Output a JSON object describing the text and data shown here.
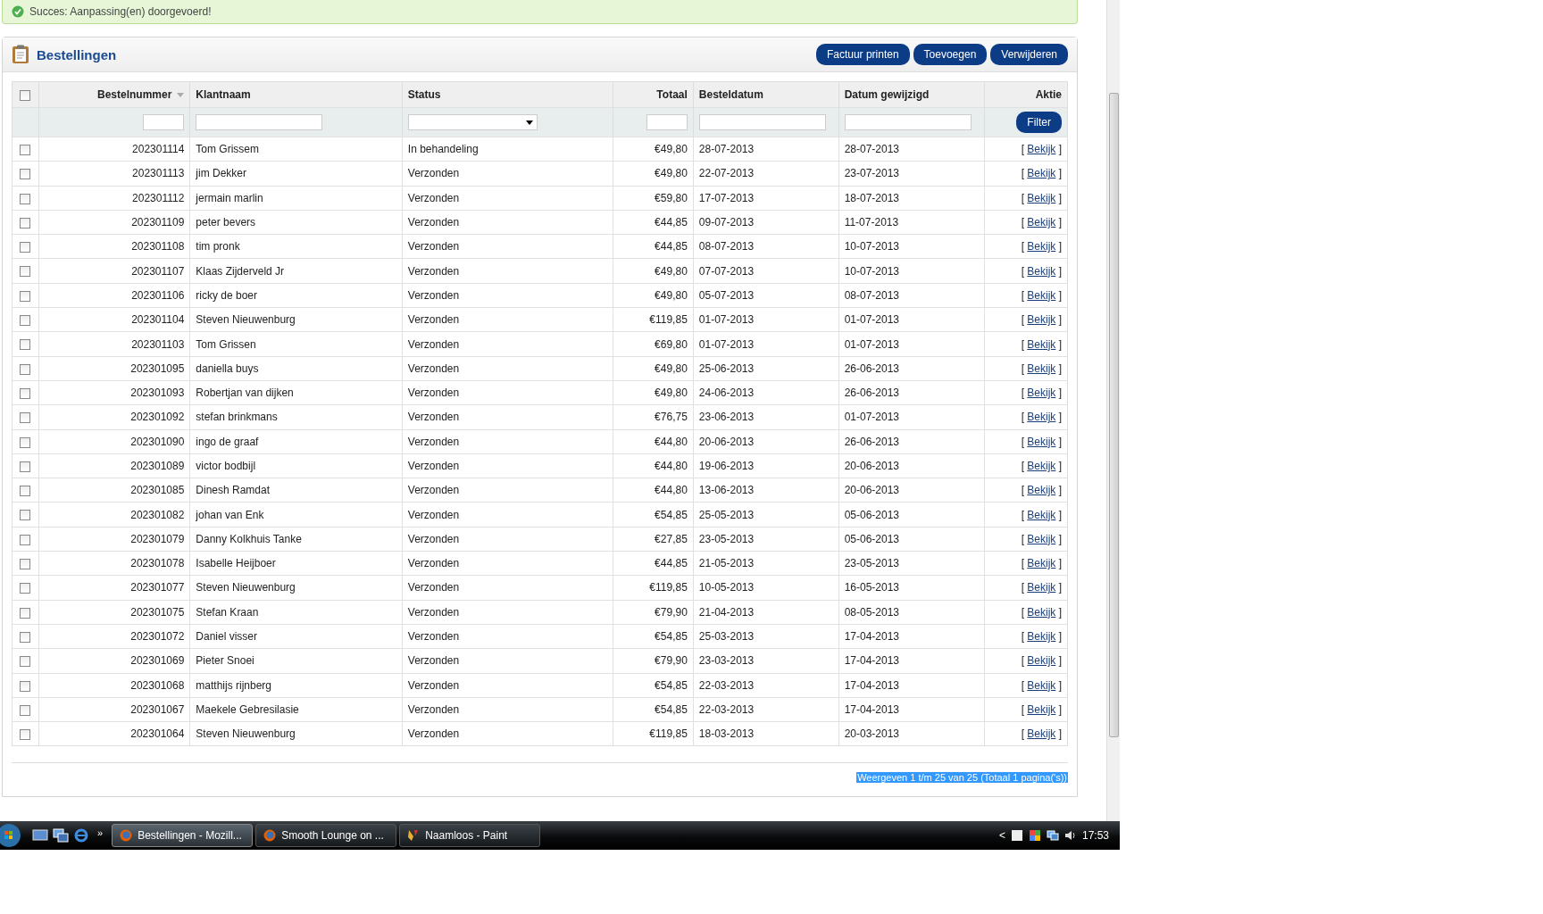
{
  "notice": {
    "text": "Succes: Aanpassing(en) doorgevoerd!"
  },
  "panel": {
    "title": "Bestellingen",
    "buttons": [
      "Factuur printen",
      "Toevoegen",
      "Verwijderen"
    ]
  },
  "table": {
    "select_all_checked": false,
    "columns": [
      {
        "label": "Bestelnummer",
        "kind": "number",
        "sorted": true
      },
      {
        "label": "Klantnaam",
        "kind": "text",
        "sorted": false
      },
      {
        "label": "Status",
        "kind": "select",
        "sorted": false
      },
      {
        "label": "Totaal",
        "kind": "money",
        "sorted": false
      },
      {
        "label": "Besteldatum",
        "kind": "date",
        "sorted": false
      },
      {
        "label": "Datum gewijzigd",
        "kind": "date",
        "sorted": false
      },
      {
        "label": "Aktie",
        "kind": "action",
        "sorted": false
      }
    ],
    "filter_button": "Filter",
    "rows": [
      {
        "checked": false,
        "cells": [
          "202301114",
          "Tom Grissem",
          "In behandeling",
          "€49,80",
          "28-07-2013",
          "28-07-2013"
        ],
        "action": {
          "open": "[",
          "label": "Bekijk",
          "close": "]"
        }
      },
      {
        "checked": false,
        "cells": [
          "202301113",
          "jim Dekker",
          "Verzonden",
          "€49,80",
          "22-07-2013",
          "23-07-2013"
        ],
        "action": {
          "open": "[",
          "label": "Bekijk",
          "close": "]"
        }
      },
      {
        "checked": false,
        "cells": [
          "202301112",
          "jermain marlin",
          "Verzonden",
          "€59,80",
          "17-07-2013",
          "18-07-2013"
        ],
        "action": {
          "open": "[",
          "label": "Bekijk",
          "close": "]"
        }
      },
      {
        "checked": false,
        "cells": [
          "202301109",
          "peter bevers",
          "Verzonden",
          "€44,85",
          "09-07-2013",
          "11-07-2013"
        ],
        "action": {
          "open": "[",
          "label": "Bekijk",
          "close": "]"
        }
      },
      {
        "checked": false,
        "cells": [
          "202301108",
          "tim pronk",
          "Verzonden",
          "€44,85",
          "08-07-2013",
          "10-07-2013"
        ],
        "action": {
          "open": "[",
          "label": "Bekijk",
          "close": "]"
        }
      },
      {
        "checked": false,
        "cells": [
          "202301107",
          "Klaas Zijderveld Jr",
          "Verzonden",
          "€49,80",
          "07-07-2013",
          "10-07-2013"
        ],
        "action": {
          "open": "[",
          "label": "Bekijk",
          "close": "]"
        }
      },
      {
        "checked": false,
        "cells": [
          "202301106",
          "ricky de boer",
          "Verzonden",
          "€49,80",
          "05-07-2013",
          "08-07-2013"
        ],
        "action": {
          "open": "[",
          "label": "Bekijk",
          "close": "]"
        }
      },
      {
        "checked": false,
        "cells": [
          "202301104",
          "Steven Nieuwenburg",
          "Verzonden",
          "€119,85",
          "01-07-2013",
          "01-07-2013"
        ],
        "action": {
          "open": "[",
          "label": "Bekijk",
          "close": "]"
        }
      },
      {
        "checked": false,
        "cells": [
          "202301103",
          "Tom Grissen",
          "Verzonden",
          "€69,80",
          "01-07-2013",
          "01-07-2013"
        ],
        "action": {
          "open": "[",
          "label": "Bekijk",
          "close": "]"
        }
      },
      {
        "checked": false,
        "cells": [
          "202301095",
          "daniella buys",
          "Verzonden",
          "€49,80",
          "25-06-2013",
          "26-06-2013"
        ],
        "action": {
          "open": "[",
          "label": "Bekijk",
          "close": "]"
        }
      },
      {
        "checked": false,
        "cells": [
          "202301093",
          "Robertjan van dijken",
          "Verzonden",
          "€49,80",
          "24-06-2013",
          "26-06-2013"
        ],
        "action": {
          "open": "[",
          "label": "Bekijk",
          "close": "]"
        }
      },
      {
        "checked": false,
        "cells": [
          "202301092",
          "stefan brinkmans",
          "Verzonden",
          "€76,75",
          "23-06-2013",
          "01-07-2013"
        ],
        "action": {
          "open": "[",
          "label": "Bekijk",
          "close": "]"
        }
      },
      {
        "checked": false,
        "cells": [
          "202301090",
          "ingo de graaf",
          "Verzonden",
          "€44,80",
          "20-06-2013",
          "26-06-2013"
        ],
        "action": {
          "open": "[",
          "label": "Bekijk",
          "close": "]"
        }
      },
      {
        "checked": false,
        "cells": [
          "202301089",
          "victor bodbijl",
          "Verzonden",
          "€44,80",
          "19-06-2013",
          "20-06-2013"
        ],
        "action": {
          "open": "[",
          "label": "Bekijk",
          "close": "]"
        }
      },
      {
        "checked": false,
        "cells": [
          "202301085",
          "Dinesh Ramdat",
          "Verzonden",
          "€44,80",
          "13-06-2013",
          "20-06-2013"
        ],
        "action": {
          "open": "[",
          "label": "Bekijk",
          "close": "]"
        }
      },
      {
        "checked": false,
        "cells": [
          "202301082",
          "johan van Enk",
          "Verzonden",
          "€54,85",
          "25-05-2013",
          "05-06-2013"
        ],
        "action": {
          "open": "[",
          "label": "Bekijk",
          "close": "]"
        }
      },
      {
        "checked": false,
        "cells": [
          "202301079",
          "Danny Kolkhuis Tanke",
          "Verzonden",
          "€27,85",
          "23-05-2013",
          "05-06-2013"
        ],
        "action": {
          "open": "[",
          "label": "Bekijk",
          "close": "]"
        }
      },
      {
        "checked": false,
        "cells": [
          "202301078",
          "Isabelle Heijboer",
          "Verzonden",
          "€44,85",
          "21-05-2013",
          "23-05-2013"
        ],
        "action": {
          "open": "[",
          "label": "Bekijk",
          "close": "]"
        }
      },
      {
        "checked": false,
        "cells": [
          "202301077",
          "Steven Nieuwenburg",
          "Verzonden",
          "€119,85",
          "10-05-2013",
          "16-05-2013"
        ],
        "action": {
          "open": "[",
          "label": "Bekijk",
          "close": "]"
        }
      },
      {
        "checked": false,
        "cells": [
          "202301075",
          "Stefan Kraan",
          "Verzonden",
          "€79,90",
          "21-04-2013",
          "08-05-2013"
        ],
        "action": {
          "open": "[",
          "label": "Bekijk",
          "close": "]"
        }
      },
      {
        "checked": false,
        "cells": [
          "202301072",
          "Daniel visser",
          "Verzonden",
          "€54,85",
          "25-03-2013",
          "17-04-2013"
        ],
        "action": {
          "open": "[",
          "label": "Bekijk",
          "close": "]"
        }
      },
      {
        "checked": false,
        "cells": [
          "202301069",
          "Pieter Snoei",
          "Verzonden",
          "€79,90",
          "23-03-2013",
          "17-04-2013"
        ],
        "action": {
          "open": "[",
          "label": "Bekijk",
          "close": "]"
        }
      },
      {
        "checked": false,
        "cells": [
          "202301068",
          "matthijs rijnberg",
          "Verzonden",
          "€54,85",
          "22-03-2013",
          "17-04-2013"
        ],
        "action": {
          "open": "[",
          "label": "Bekijk",
          "close": "]"
        }
      },
      {
        "checked": false,
        "cells": [
          "202301067",
          "Maekele Gebresilasie",
          "Verzonden",
          "€54,85",
          "22-03-2013",
          "17-04-2013"
        ],
        "action": {
          "open": "[",
          "label": "Bekijk",
          "close": "]"
        }
      },
      {
        "checked": false,
        "cells": [
          "202301064",
          "Steven Nieuwenburg",
          "Verzonden",
          "€119,85",
          "18-03-2013",
          "20-03-2013"
        ],
        "action": {
          "open": "[",
          "label": "Bekijk",
          "close": "]"
        }
      }
    ]
  },
  "pagination": {
    "text": "Weergeven 1 t/m 25 van 25 (Totaal 1 pagina('s))",
    "selected": true
  },
  "taskbar": {
    "overflow": "»",
    "tasks": [
      {
        "label": "Bestellingen - Mozill...",
        "kind": "firefox",
        "selected": true
      },
      {
        "label": "Smooth Lounge on ...",
        "kind": "firefox",
        "selected": false
      },
      {
        "label": "Naamloos - Paint",
        "kind": "paint",
        "selected": false
      }
    ],
    "tray_arrow": "<",
    "clock": "17:53"
  }
}
